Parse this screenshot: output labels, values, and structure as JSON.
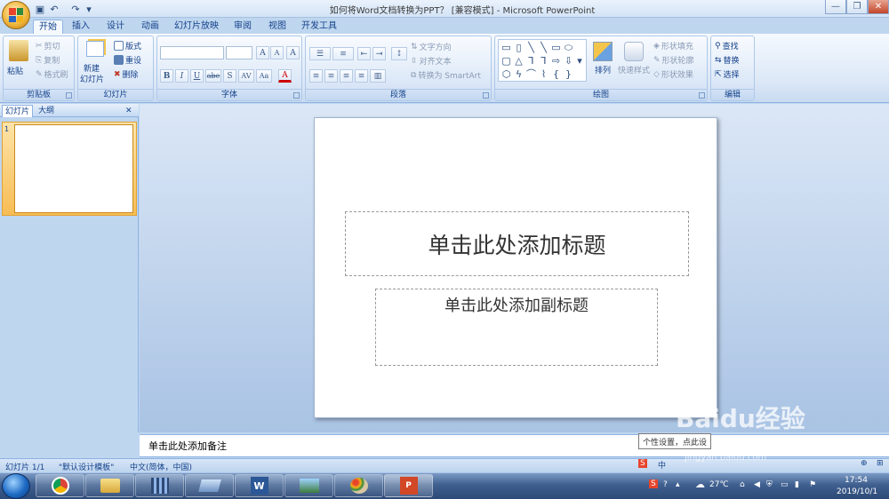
{
  "window": {
    "title": "如何将Word文档转换为PPT？ [兼容模式] - Microsoft PowerPoint",
    "minimize_glyph": "—",
    "restore_glyph": "❐",
    "close_glyph": "✕"
  },
  "tabs": [
    {
      "label": "开始",
      "active": true
    },
    {
      "label": "插入"
    },
    {
      "label": "设计"
    },
    {
      "label": "动画"
    },
    {
      "label": "幻灯片放映"
    },
    {
      "label": "审阅"
    },
    {
      "label": "视图"
    },
    {
      "label": "开发工具"
    }
  ],
  "ribbon": {
    "clipboard": {
      "group": "剪贴板",
      "paste": "粘贴",
      "cut": "剪切",
      "copy": "复制",
      "format_painter": "格式刷"
    },
    "slides": {
      "group": "幻灯片",
      "new_slide": "新建",
      "new_slide2": "幻灯片",
      "layout": "版式",
      "reset": "重设",
      "delete": "删除"
    },
    "font": {
      "group": "字体",
      "grow": "A",
      "shrink": "A",
      "clear": "A",
      "bold": "B",
      "italic": "I",
      "underline": "U",
      "strike": "abe",
      "shadow": "S",
      "spacing": "AV",
      "case": "Aa",
      "color": "A"
    },
    "paragraph": {
      "group": "段落",
      "text_direction": "文字方向",
      "align_text": "对齐文本",
      "smartart": "转换为 SmartArt"
    },
    "drawing": {
      "group": "绘图",
      "arrange": "排列",
      "quick_styles": "快速样式",
      "shape_fill": "形状填充",
      "shape_outline": "形状轮廓",
      "shape_effects": "形状效果"
    },
    "editing": {
      "group": "编辑",
      "find": "查找",
      "replace": "替换",
      "select": "选择"
    }
  },
  "panes": {
    "slides_tab": "幻灯片",
    "outline_tab": "大纲",
    "close_glyph": "✕",
    "thumb_number": "1"
  },
  "slide": {
    "title_placeholder": "单击此处添加标题",
    "subtitle_placeholder": "单击此处添加副标题"
  },
  "notes": {
    "placeholder": "单击此处添加备注"
  },
  "status": {
    "slide_count": "幻灯片 1/1",
    "theme": "\"默认设计模板\"",
    "language": "中文(简体，中国)"
  },
  "tooltip": "个性设置，点此设",
  "watermark": {
    "brand": "Baidu经验",
    "url": "jingyan.baidu.com"
  },
  "taskbar": {
    "temperature": "27℃",
    "time": "17:54",
    "date": "2019/10/1",
    "ime_label": "中"
  },
  "colors": {
    "ribbon_text": "#15428b",
    "selection": "#f7bd55",
    "taskbar": "#3f5f8f"
  }
}
